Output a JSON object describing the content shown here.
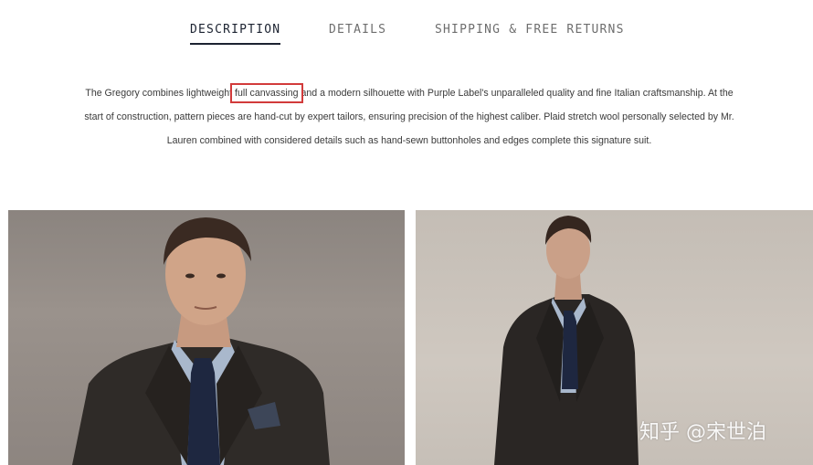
{
  "tabs": [
    {
      "label": "DESCRIPTION",
      "active": true
    },
    {
      "label": "DETAILS",
      "active": false
    },
    {
      "label": "SHIPPING & FREE RETURNS",
      "active": false
    }
  ],
  "description": {
    "before": "The Gregory combines lightweight ",
    "highlight": "full canvassing",
    "after": " and a modern silhouette with Purple Label's unparalleled quality and fine Italian craftsmanship. At the start of construction, pattern pieces are hand-cut by expert tailors, ensuring precision of the highest caliber. Plaid stretch wool personally selected by Mr. Lauren combined with considered details such as hand-sewn buttonholes and edges complete this signature suit."
  },
  "watermark": "知乎 @宋世泊",
  "colors": {
    "accent": "#1c2331",
    "highlight_box": "#d23b3b",
    "suit": "#2f2b28",
    "tie": "#1e2740",
    "shirt": "#a9b8cc"
  },
  "images": [
    {
      "name": "model-close-up",
      "subject": "man in dark charcoal suit, light blue shirt, navy tie"
    },
    {
      "name": "model-full-view",
      "subject": "man in dark charcoal suit standing, light background"
    }
  ]
}
